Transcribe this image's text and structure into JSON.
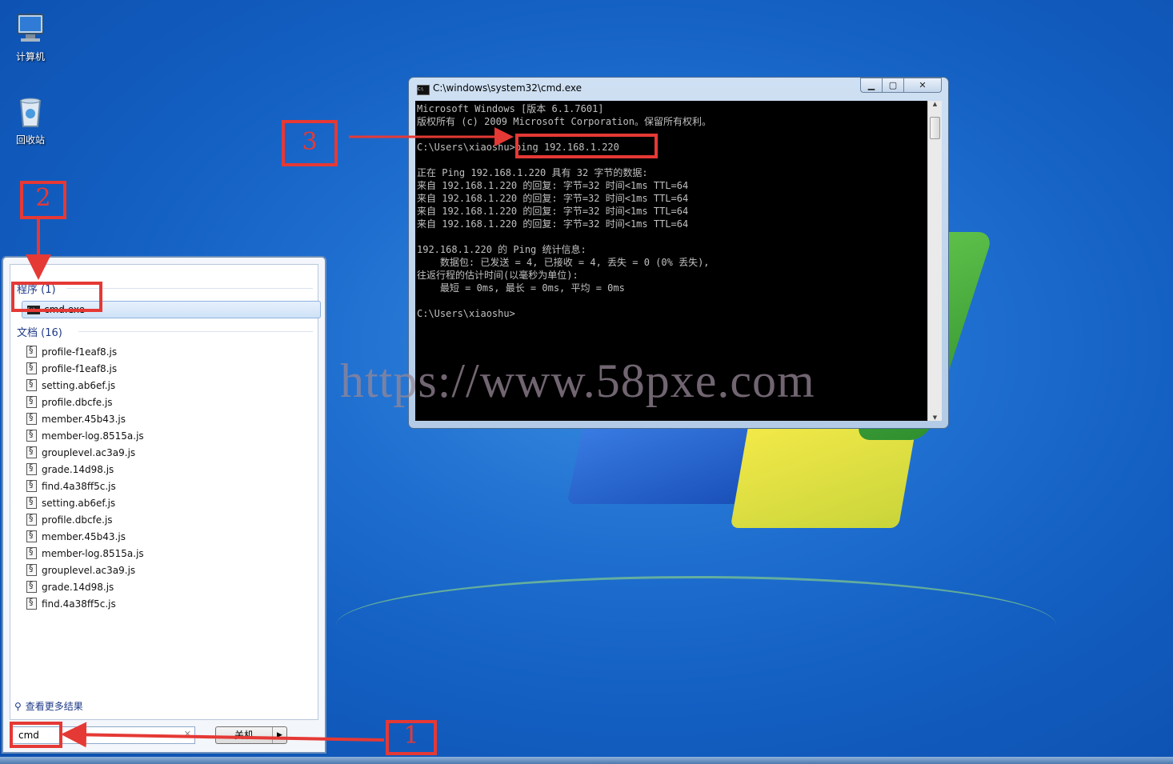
{
  "desktop": {
    "icons": [
      {
        "label": "计算机"
      },
      {
        "label": "回收站"
      }
    ]
  },
  "start_menu": {
    "programs_header": "程序 (1)",
    "program_item": "cmd.exe",
    "documents_header": "文档 (16)",
    "documents": [
      "profile-f1eaf8.js",
      "profile-f1eaf8.js",
      "setting.ab6ef.js",
      "profile.dbcfe.js",
      "member.45b43.js",
      "member-log.8515a.js",
      "grouplevel.ac3a9.js",
      "grade.14d98.js",
      "find.4a38ff5c.js",
      "setting.ab6ef.js",
      "profile.dbcfe.js",
      "member.45b43.js",
      "member-log.8515a.js",
      "grouplevel.ac3a9.js",
      "grade.14d98.js",
      "find.4a38ff5c.js"
    ],
    "more_results": "查看更多结果",
    "search_value": "cmd",
    "shutdown_label": "关机"
  },
  "cmd_window": {
    "title": "C:\\windows\\system32\\cmd.exe",
    "output": "Microsoft Windows [版本 6.1.7601]\n版权所有 (c) 2009 Microsoft Corporation。保留所有权利。\n\nC:\\Users\\xiaoshu>ping 192.168.1.220\n\n正在 Ping 192.168.1.220 具有 32 字节的数据:\n来自 192.168.1.220 的回复: 字节=32 时间<1ms TTL=64\n来自 192.168.1.220 的回复: 字节=32 时间<1ms TTL=64\n来自 192.168.1.220 的回复: 字节=32 时间<1ms TTL=64\n来自 192.168.1.220 的回复: 字节=32 时间<1ms TTL=64\n\n192.168.1.220 的 Ping 统计信息:\n    数据包: 已发送 = 4, 已接收 = 4, 丢失 = 0 (0% 丢失),\n往返行程的估计时间(以毫秒为单位):\n    最短 = 0ms, 最长 = 0ms, 平均 = 0ms\n\nC:\\Users\\xiaoshu>"
  },
  "annotations": {
    "step1": "1",
    "step2": "2",
    "step3": "3",
    "color": "#e53935"
  },
  "watermark": "https://www.58pxe.com"
}
